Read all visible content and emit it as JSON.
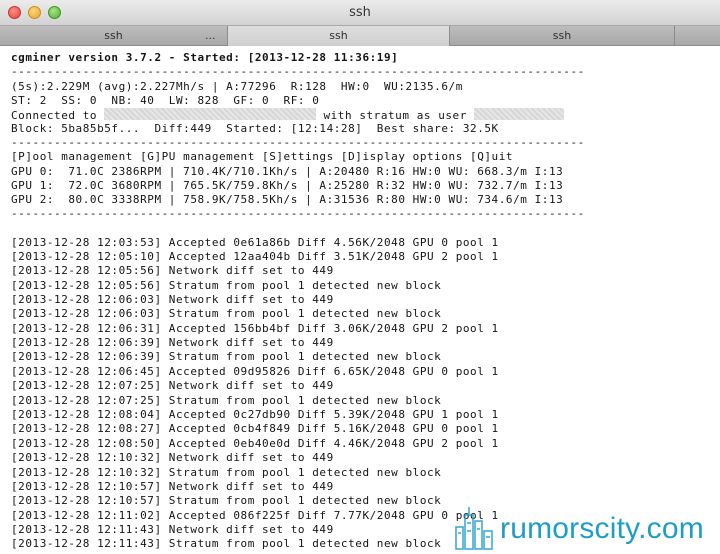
{
  "window": {
    "title": "ssh",
    "tabs": [
      "ssh",
      "ssh",
      "ssh"
    ],
    "overflow": "..."
  },
  "terminal": {
    "version_line": "cgminer version 3.7.2 - Started: [2013-12-28 11:36:19]",
    "divider": "--------------------------------------------------------------------------------",
    "stats": "(5s):2.229M (avg):2.227Mh/s | A:77296  R:128  HW:0  WU:2135.6/m",
    "status": "ST: 2  SS: 0  NB: 40  LW: 828  GF: 0  RF: 0",
    "connected_prefix": "Connected to",
    "connected_middle": "with stratum as user",
    "block": "Block: 5ba85b5f...  Diff:449  Started: [12:14:28]  Best share: 32.5K",
    "menu": "[P]ool management [G]PU management [S]ettings [D]isplay options [Q]uit",
    "gpus": [
      "GPU 0:  71.0C 2386RPM | 710.4K/710.1Kh/s | A:20480 R:16 HW:0 WU: 668.3/m I:13",
      "GPU 1:  72.0C 3680RPM | 765.5K/759.8Kh/s | A:25280 R:32 HW:0 WU: 732.7/m I:13",
      "GPU 2:  80.0C 3338RPM | 758.9K/758.5Kh/s | A:31536 R:80 HW:0 WU: 734.6/m I:13"
    ],
    "log": [
      "[2013-12-28 12:03:53] Accepted 0e61a86b Diff 4.56K/2048 GPU 0 pool 1",
      "[2013-12-28 12:05:10] Accepted 12aa404b Diff 3.51K/2048 GPU 2 pool 1",
      "[2013-12-28 12:05:56] Network diff set to 449",
      "[2013-12-28 12:05:56] Stratum from pool 1 detected new block",
      "[2013-12-28 12:06:03] Network diff set to 449",
      "[2013-12-28 12:06:03] Stratum from pool 1 detected new block",
      "[2013-12-28 12:06:31] Accepted 156bb4bf Diff 3.06K/2048 GPU 2 pool 1",
      "[2013-12-28 12:06:39] Network diff set to 449",
      "[2013-12-28 12:06:39] Stratum from pool 1 detected new block",
      "[2013-12-28 12:06:45] Accepted 09d95826 Diff 6.65K/2048 GPU 0 pool 1",
      "[2013-12-28 12:07:25] Network diff set to 449",
      "[2013-12-28 12:07:25] Stratum from pool 1 detected new block",
      "[2013-12-28 12:08:04] Accepted 0c27db90 Diff 5.39K/2048 GPU 1 pool 1",
      "[2013-12-28 12:08:27] Accepted 0cb4f849 Diff 5.16K/2048 GPU 0 pool 1",
      "[2013-12-28 12:08:50] Accepted 0eb40e0d Diff 4.46K/2048 GPU 2 pool 1",
      "[2013-12-28 12:10:32] Network diff set to 449",
      "[2013-12-28 12:10:32] Stratum from pool 1 detected new block",
      "[2013-12-28 12:10:57] Network diff set to 449",
      "[2013-12-28 12:10:57] Stratum from pool 1 detected new block",
      "[2013-12-28 12:11:02] Accepted 086f225f Diff 7.77K/2048 GPU 0 pool 1",
      "[2013-12-28 12:11:43] Network diff set to 449",
      "[2013-12-28 12:11:43] Stratum from pool 1 detected new block"
    ]
  },
  "watermark": {
    "text": "rumorscity.com",
    "icon": "city-skyline-icon",
    "color": "#1e9dc9"
  }
}
